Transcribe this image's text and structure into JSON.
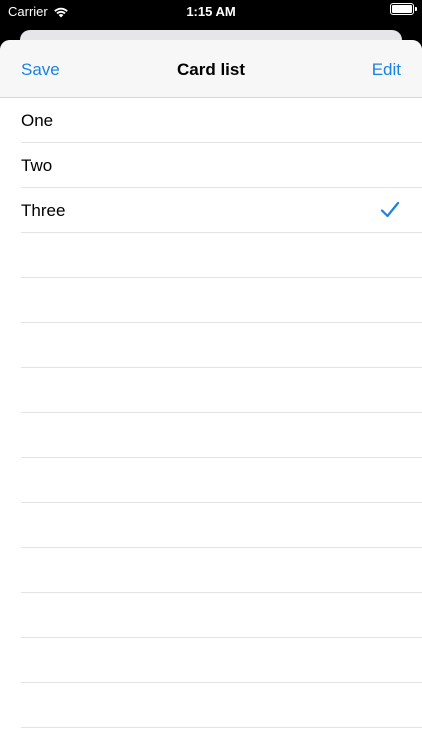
{
  "status": {
    "carrier": "Carrier",
    "time": "1:15 AM"
  },
  "nav": {
    "left_button": "Save",
    "title": "Card list",
    "right_button": "Edit"
  },
  "list": {
    "rows": [
      {
        "label": "One",
        "checked": false
      },
      {
        "label": "Two",
        "checked": false
      },
      {
        "label": "Three",
        "checked": true
      }
    ],
    "empty_rows": 11
  },
  "colors": {
    "accent": "#1a82e3",
    "nav_background": "#f7f7f7",
    "separator": "#e4e4e6"
  },
  "icons": {
    "status_wifi": "wifi-icon",
    "status_battery": "battery-icon",
    "row_checkmark": "checkmark-icon"
  }
}
